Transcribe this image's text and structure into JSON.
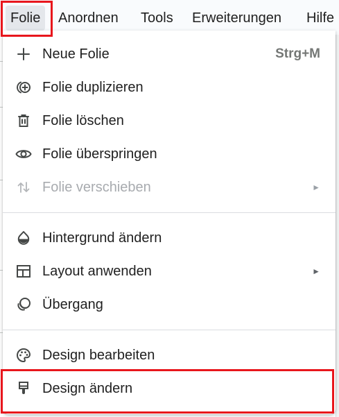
{
  "menubar": {
    "items": [
      {
        "label": "Folie",
        "active": true
      },
      {
        "label": "Anordnen"
      },
      {
        "label": "Tools"
      },
      {
        "label": "Erweiterungen"
      },
      {
        "label": "Hilfe"
      }
    ]
  },
  "menu": {
    "items": [
      {
        "label": "Neue Folie",
        "shortcut": "Strg+M",
        "icon": "plus-icon"
      },
      {
        "label": "Folie duplizieren",
        "icon": "duplicate-icon"
      },
      {
        "label": "Folie löschen",
        "icon": "trash-icon"
      },
      {
        "label": "Folie überspringen",
        "icon": "eye-icon"
      },
      {
        "label": "Folie verschieben",
        "icon": "move-arrows-icon",
        "disabled": true,
        "submenu_arrow": "►"
      },
      {
        "label": "Hintergrund ändern",
        "icon": "water-drop-icon"
      },
      {
        "label": "Layout anwenden",
        "icon": "layout-icon",
        "submenu_arrow": "►"
      },
      {
        "label": "Übergang",
        "icon": "transition-icon"
      },
      {
        "label": "Design bearbeiten",
        "icon": "palette-icon"
      },
      {
        "label": "Design ändern",
        "icon": "paint-brush-icon"
      }
    ]
  },
  "colors": {
    "highlight": "#e8161c",
    "menubar_active": "#e4e7eb",
    "text": "#1f1f1f",
    "disabled_text": "#a8abaf",
    "shortcut_text": "#747775",
    "icon": "#444746"
  }
}
